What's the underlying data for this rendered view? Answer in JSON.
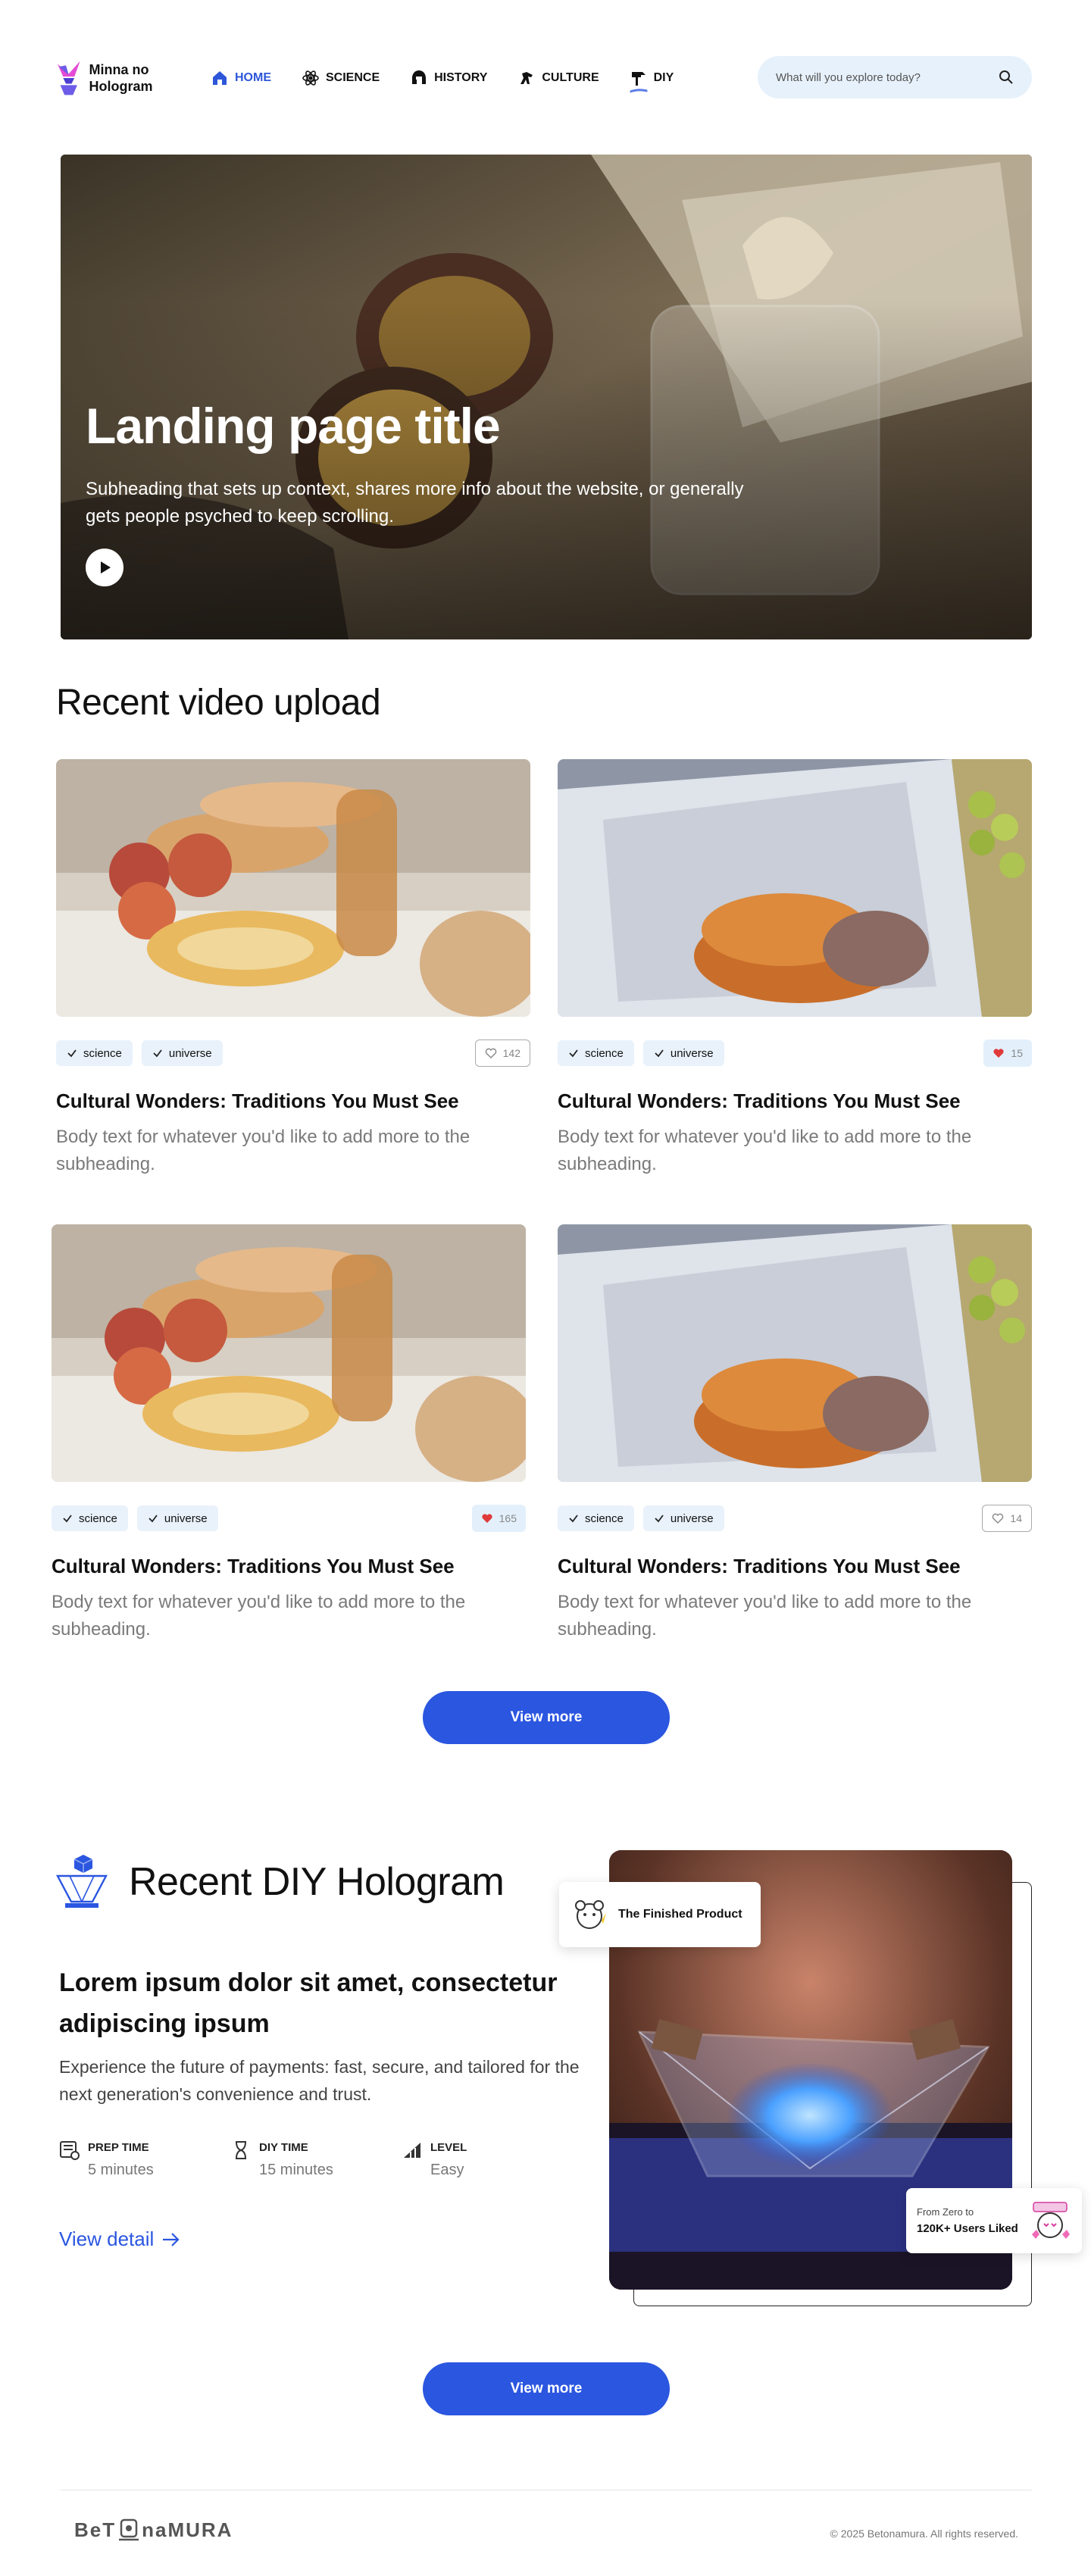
{
  "nav": {
    "brand": "Minna no Hologram",
    "items": [
      {
        "label": "HOME",
        "icon": "home-icon",
        "active": true
      },
      {
        "label": "SCIENCE",
        "icon": "atom-icon",
        "active": false
      },
      {
        "label": "HISTORY",
        "icon": "spartan-helmet-icon",
        "active": false
      },
      {
        "label": "CULTURE",
        "icon": "horse-icon",
        "active": false
      },
      {
        "label": "DIY",
        "icon": "hammer-icon",
        "active": false
      }
    ],
    "search_placeholder": "What will you explore today?",
    "active_color": "#2d56d9"
  },
  "hero": {
    "title": "Landing page title",
    "subtitle": "Subheading that sets up context, shares more info about the website, or generally gets people psyched to keep scrolling."
  },
  "recent": {
    "title": "Recent video upload",
    "cards": [
      {
        "tags": [
          "science",
          "universe"
        ],
        "likes": "142",
        "liked": false,
        "title": "Cultural Wonders: Traditions You Must See",
        "body": "Body text for whatever you'd like to add more to the subheading."
      },
      {
        "tags": [
          "science",
          "universe"
        ],
        "likes": "15",
        "liked": true,
        "title": "Cultural Wonders: Traditions You Must See",
        "body": "Body text for whatever you'd like to add more to the subheading."
      },
      {
        "tags": [
          "science",
          "universe"
        ],
        "likes": "165",
        "liked": true,
        "title": "Cultural Wonders: Traditions You Must See",
        "body": "Body text for whatever you'd like to add more to the subheading."
      },
      {
        "tags": [
          "science",
          "universe"
        ],
        "likes": "14",
        "liked": false,
        "title": "Cultural Wonders: Traditions You Must See",
        "body": "Body text for whatever you'd like to add more to the subheading."
      }
    ],
    "view_more": "View more"
  },
  "diy": {
    "heading": "Recent DIY Hologram",
    "title": "Lorem ipsum dolor sit amet, consectetur adipiscing ipsum",
    "text": "Experience the future of payments: fast, secure, and tailored for the next generation's convenience and trust.",
    "stats": [
      {
        "label": "PREP TIME",
        "value": "5 minutes",
        "icon": "recipe-book-icon"
      },
      {
        "label": "DIY TIME",
        "value": "15 minutes",
        "icon": "hourglass-icon"
      },
      {
        "label": "LEVEL",
        "value": "Easy",
        "icon": "level-bars-icon"
      }
    ],
    "view_detail": "View detail",
    "badge1": "The Finished Product",
    "badge2_small": "From Zero to",
    "badge2_big": "120K+ Users Liked",
    "view_more": "View more",
    "accent": "#2b56e0"
  },
  "footer": {
    "logo_left": "BeT",
    "logo_right": "naMURA",
    "copyright": "© 2025 Betonamura. All rights reserved."
  }
}
